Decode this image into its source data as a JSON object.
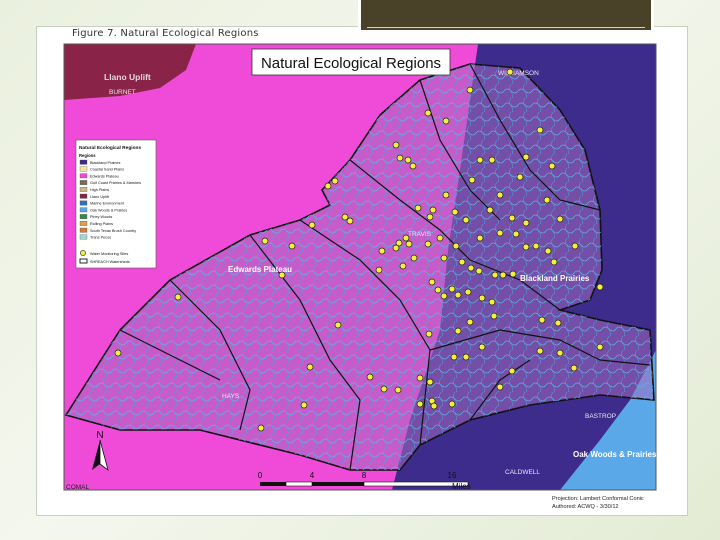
{
  "caption": "Figure 7. Natural Ecological Regions",
  "map": {
    "title": "Natural Ecological Regions",
    "region_labels": {
      "llano": "Llano Uplift",
      "edwards": "Edwards Plateau",
      "blackland": "Blackland Prairies",
      "oak": "Oak Woods & Prairies"
    },
    "county_labels": {
      "burnet": "BURNET",
      "williamson": "WILLIAMSON",
      "travis": "TRAVIS",
      "hays": "HAYS",
      "bastrop": "BASTROP",
      "caldwell": "CALDWELL",
      "comal": "COMAL"
    },
    "legend": {
      "title": "Natural Ecological Regions",
      "subtitle": "Regions",
      "items": [
        {
          "label": "Blackland Prairies",
          "color": "#3d2c8c"
        },
        {
          "label": "Coastal Sand Plains",
          "color": "#f2e3a0"
        },
        {
          "label": "Edwards Plateau",
          "color": "#f04bd8"
        },
        {
          "label": "Gulf Coast Prairies & Marshes",
          "color": "#7a6a58"
        },
        {
          "label": "High Plains",
          "color": "#c9b98a"
        },
        {
          "label": "Llano Uplift",
          "color": "#8a2348"
        },
        {
          "label": "Marine Environment",
          "color": "#2f6bc9"
        },
        {
          "label": "Oak Woods & Prairies",
          "color": "#5aa8e8"
        },
        {
          "label": "Piney Woods",
          "color": "#2e8f4a"
        },
        {
          "label": "Rolling Plains",
          "color": "#d4a25a"
        },
        {
          "label": "South Texas Brush Country",
          "color": "#d2783a"
        },
        {
          "label": "Trans Pecos",
          "color": "#9ed6d0"
        }
      ],
      "sites_label": "Water Monitoring Sites",
      "watersheds_label": "SHREACH Watersheds"
    },
    "scale": {
      "ticks": [
        "0",
        "4",
        "8",
        "16"
      ],
      "unit": "Miles"
    },
    "north": "N",
    "projection": "Projection: Lambert Conformal Conic",
    "authored": "Authored: ACWQ - 3/30/12",
    "colors": {
      "edwards": "#f04bd8",
      "blackland": "#3d2c8c",
      "llano": "#8a2348",
      "oak": "#5aa8e8",
      "watershed_fill": "#a46cc0",
      "streams": "#5fb6e6",
      "sites": "#f5ee3c"
    }
  }
}
